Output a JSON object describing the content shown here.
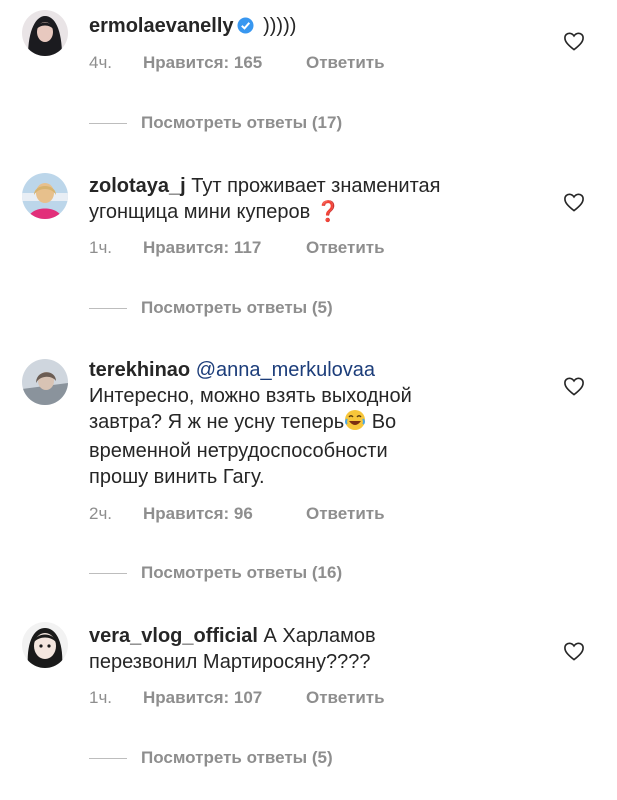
{
  "comments": [
    {
      "username": "ermolaevanelly",
      "verified": true,
      "text": " )))))",
      "time": "4ч.",
      "likes": "Нравится: 165",
      "reply": "Ответить",
      "view_replies": "Посмотреть ответы (17)"
    },
    {
      "username": "zolotaya_j",
      "text_line1": " Тут проживает знаменитая",
      "text_line2": "угонщица мини куперов ",
      "emoji": "❓",
      "time": "1ч.",
      "likes": "Нравится: 117",
      "reply": "Ответить",
      "view_replies": "Посмотреть ответы (5)"
    },
    {
      "username": "terekhinao",
      "mention": "@anna_merkulovaa",
      "line2": "Интересно, можно взять выходной",
      "line3a": "завтра? Я ж не усну теперь",
      "emoji": "😂",
      "line3b": " Во",
      "line4": "временной нетрудоспособности",
      "line5": "прошу винить Гагу.",
      "time": "2ч.",
      "likes": "Нравится: 96",
      "reply": "Ответить",
      "view_replies": "Посмотреть ответы (16)"
    },
    {
      "username": "vera_vlog_official",
      "text_line1": " А Харламов",
      "text_line2": "перезвонил Мартиросяну????",
      "time": "1ч.",
      "likes": "Нравится: 107",
      "reply": "Ответить",
      "view_replies": "Посмотреть ответы (5)"
    }
  ],
  "colors": {
    "text": "#262626",
    "muted": "#8e8e8e",
    "mention": "#1c3d7a",
    "verified": "#3897f0",
    "emoji_red": "#e0262b"
  }
}
